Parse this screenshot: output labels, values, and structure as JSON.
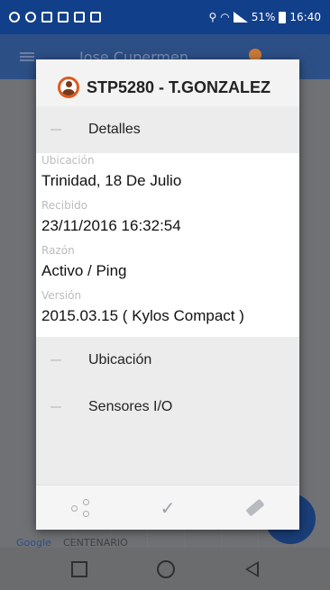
{
  "statusbar": {
    "battery": "51%",
    "time": "16:40"
  },
  "background": {
    "title": "Jose Cupermen",
    "map_brand": "Google",
    "map_label": "CENTENARIO"
  },
  "dialog": {
    "title": "STP5280 - T.GONZALEZ",
    "sections": {
      "details": "Detalles",
      "location": "Ubicación",
      "sensors": "Sensores I/O"
    },
    "fields": [
      {
        "label": "Ubicación",
        "value": "Trinidad, 18 De Julio"
      },
      {
        "label": "Recibido",
        "value": "23/11/2016 16:32:54"
      },
      {
        "label": "Razón",
        "value": "Activo / Ping"
      },
      {
        "label": "Versión",
        "value": "2015.03.15 ( Kylos Compact )"
      }
    ],
    "actions": [
      {
        "name": "share",
        "icon": "share-icon"
      },
      {
        "name": "confirm",
        "icon": "check-icon",
        "glyph": "✓"
      },
      {
        "name": "ping",
        "icon": "ping-icon"
      }
    ]
  }
}
